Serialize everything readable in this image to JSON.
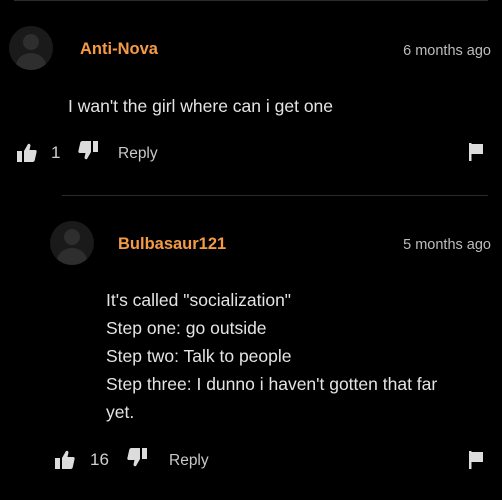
{
  "comments": [
    {
      "username": "Anti-Nova",
      "time": "6 months ago",
      "lines": [
        "I wan't the girl where can i get one"
      ],
      "likes": "1",
      "reply_label": "Reply",
      "icons": {
        "avatar": "default-avatar-icon",
        "like": "thumbs-up-icon",
        "dislike": "thumbs-down-icon",
        "flag": "flag-icon"
      }
    },
    {
      "username": "Bulbasaur121",
      "time": "5 months ago",
      "lines": [
        "It's called \"socialization\"",
        "Step one: go outside",
        "Step two: Talk to people",
        "Step three: I dunno i haven't gotten that far",
        "yet."
      ],
      "likes": "16",
      "reply_label": "Reply",
      "icons": {
        "avatar": "default-avatar-icon",
        "like": "thumbs-up-icon",
        "dislike": "thumbs-down-icon",
        "flag": "flag-icon"
      }
    }
  ],
  "colors": {
    "background": "#000000",
    "username": "#f59b45",
    "text": "#e4e4e4",
    "meta": "#bdbdbd"
  }
}
